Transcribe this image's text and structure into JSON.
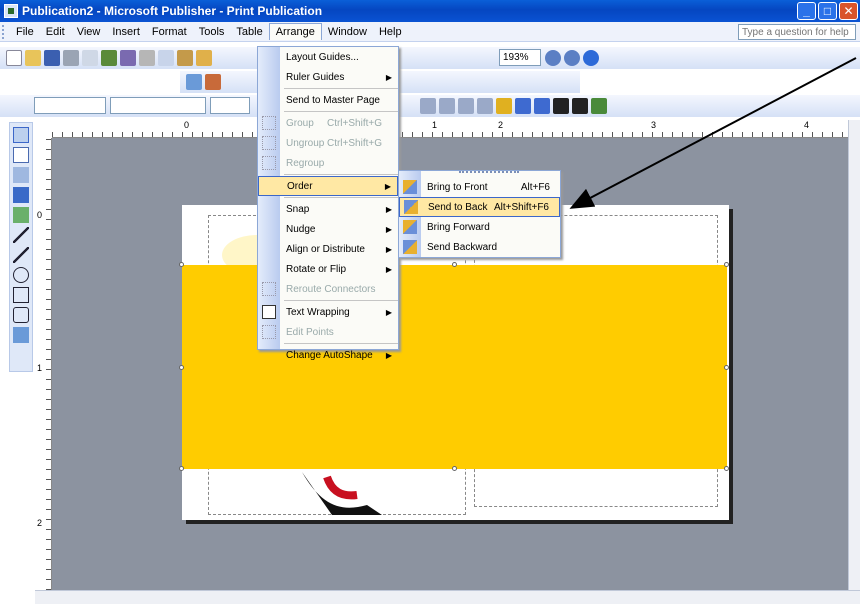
{
  "window": {
    "title": "Publication2 - Microsoft Publisher - Print Publication"
  },
  "menubar": {
    "items": [
      "File",
      "Edit",
      "View",
      "Insert",
      "Format",
      "Tools",
      "Table",
      "Arrange",
      "Window",
      "Help"
    ],
    "help_placeholder": "Type a question for help"
  },
  "toolbar": {
    "zoom": "193%"
  },
  "ruler": {
    "h_marks": [
      "0",
      "1",
      "2",
      "3",
      "4"
    ],
    "v_marks": [
      "0",
      "1",
      "2"
    ]
  },
  "arrange_menu": {
    "items": [
      {
        "label": "Layout Guides...",
        "state": "normal",
        "submenu": false
      },
      {
        "label": "Ruler Guides",
        "state": "normal",
        "submenu": true
      },
      {
        "label": "Send to Master Page",
        "state": "normal",
        "submenu": false
      },
      {
        "label": "Group",
        "shortcut": "Ctrl+Shift+G",
        "state": "disabled",
        "submenu": false
      },
      {
        "label": "Ungroup",
        "shortcut": "Ctrl+Shift+G",
        "state": "disabled",
        "submenu": false
      },
      {
        "label": "Regroup",
        "state": "disabled",
        "submenu": false
      },
      {
        "label": "Order",
        "state": "highlighted",
        "submenu": true
      },
      {
        "label": "Snap",
        "state": "normal",
        "submenu": true
      },
      {
        "label": "Nudge",
        "state": "normal",
        "submenu": true
      },
      {
        "label": "Align or Distribute",
        "state": "normal",
        "submenu": true
      },
      {
        "label": "Rotate or Flip",
        "state": "normal",
        "submenu": true
      },
      {
        "label": "Reroute Connectors",
        "state": "disabled",
        "submenu": false
      },
      {
        "label": "Text Wrapping",
        "state": "normal",
        "submenu": true
      },
      {
        "label": "Edit Points",
        "state": "disabled",
        "submenu": false
      },
      {
        "label": "Change AutoShape",
        "state": "normal",
        "submenu": true
      }
    ]
  },
  "order_menu": {
    "items": [
      {
        "label": "Bring to Front",
        "shortcut": "Alt+F6",
        "state": "normal"
      },
      {
        "label": "Send to Back",
        "shortcut": "Alt+Shift+F6",
        "state": "highlighted"
      },
      {
        "label": "Bring Forward",
        "shortcut": "",
        "state": "normal"
      },
      {
        "label": "Send Backward",
        "shortcut": "",
        "state": "normal"
      }
    ]
  },
  "colors": {
    "shape_fill": "#ffcc00",
    "title_bar": "#0a53d3",
    "menu_highlight": "#ffe8a4",
    "workspace": "#8c93a0"
  }
}
